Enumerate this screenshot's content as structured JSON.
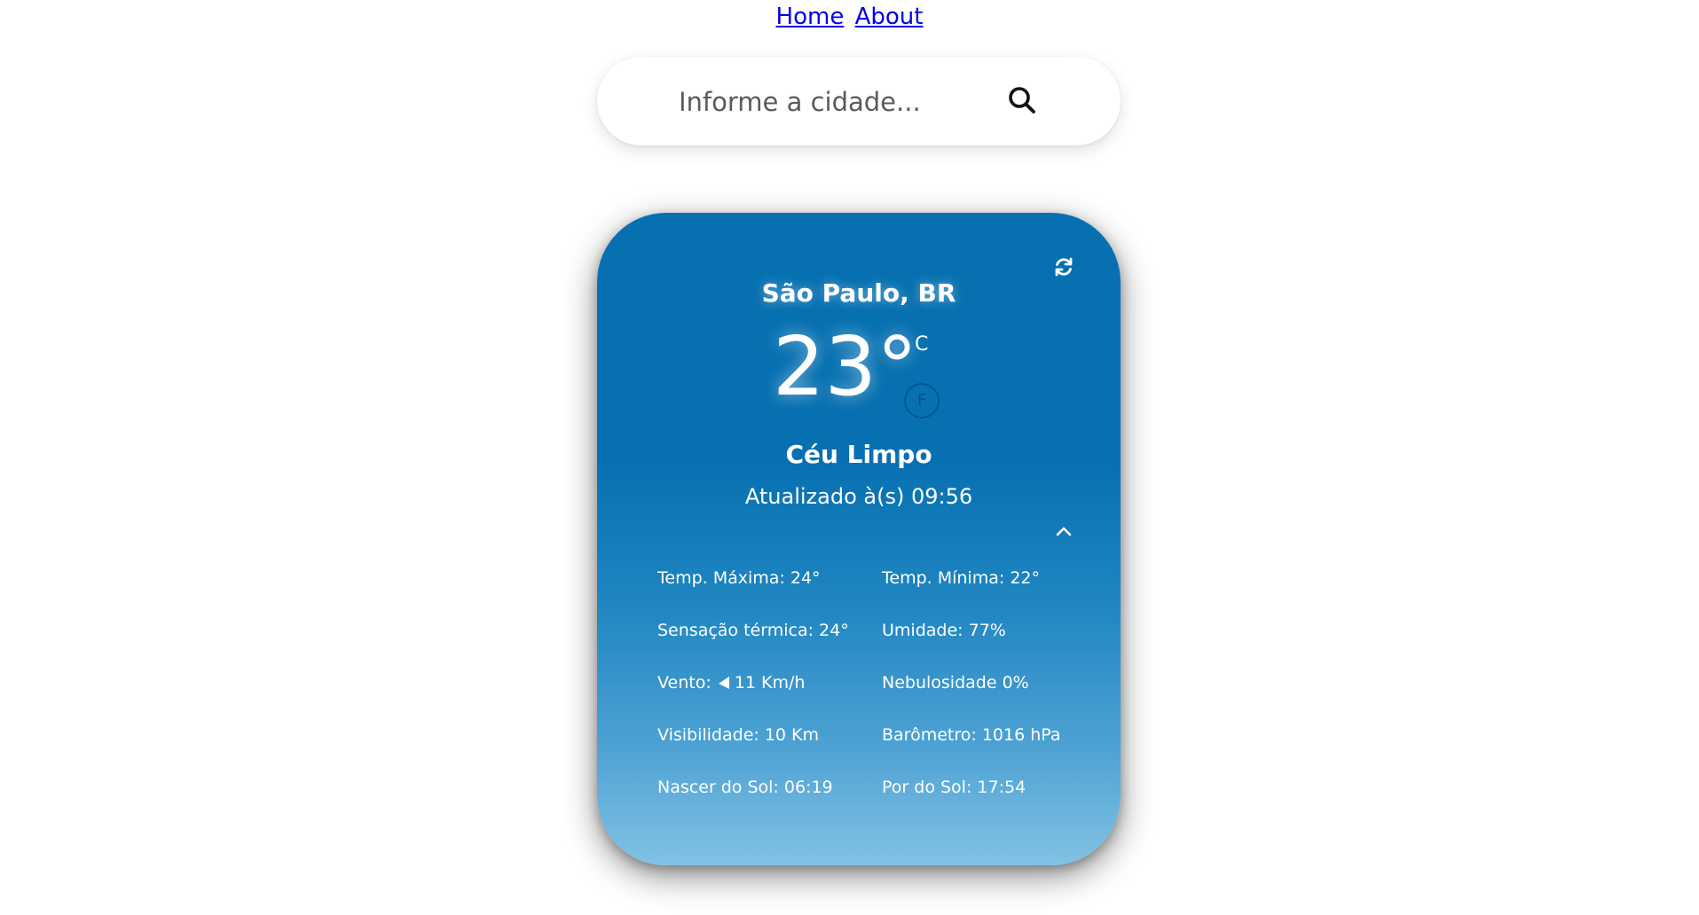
{
  "nav": {
    "home": "Home",
    "about": "About"
  },
  "search": {
    "placeholder": "Informe a cidade...",
    "icon": "search-icon"
  },
  "weather": {
    "city": "São Paulo, BR",
    "temperature": "23°",
    "unit_c": "C",
    "unit_f": "F",
    "description": "Céu Limpo",
    "updated": "Atualizado à(s) 09:56",
    "details": {
      "temp_max_label": "Temp. Máxima:",
      "temp_max_value": "24°",
      "temp_min_label": "Temp. Mínima:",
      "temp_min_value": "22°",
      "feels_label": "Sensação térmica:",
      "feels_value": "24°",
      "humidity_label": "Umidade:",
      "humidity_value": "77%",
      "wind_label": "Vento:",
      "wind_value": "11 Km/h",
      "clouds_label": "Nebulosidade",
      "clouds_value": "0%",
      "visibility_label": "Visibilidade:",
      "visibility_value": "10 Km",
      "pressure_label": "Barômetro:",
      "pressure_value": "1016 hPa",
      "sunrise_label": "Nascer do Sol:",
      "sunrise_value": "06:19",
      "sunset_label": "Por do Sol:",
      "sunset_value": "17:54"
    }
  },
  "colors": {
    "card_top": "#0670b0",
    "card_bottom": "#82c2e4",
    "link": "#0000ee"
  }
}
